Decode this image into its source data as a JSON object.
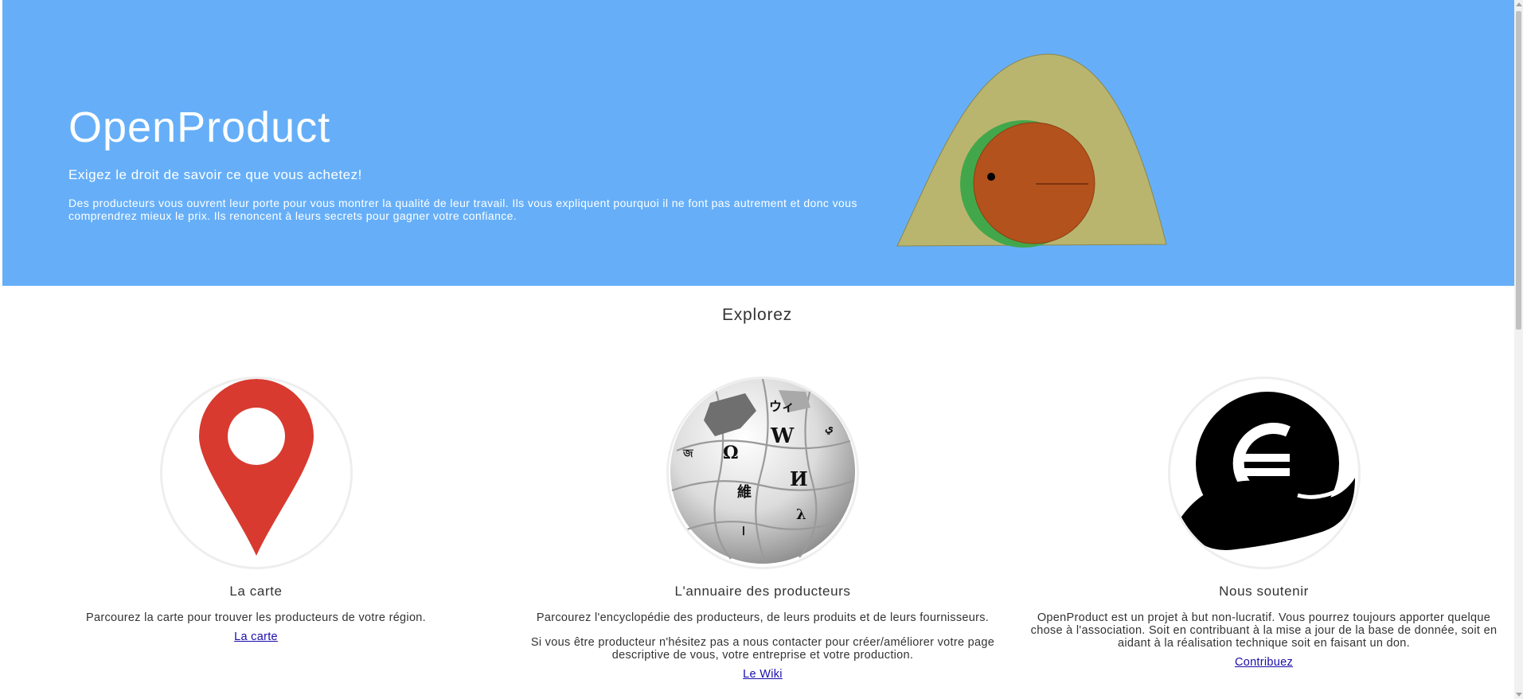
{
  "hero": {
    "title": "OpenProduct",
    "tagline": "Exigez le droit de savoir ce que vous achetez!",
    "description": "Des producteurs vous ouvrent leur porte pour vous montrer la qualité de leur travail. Ils vous expliquent pourquoi il ne font pas autrement et donc vous comprendrez mieux le prix. Ils renoncent à leurs secrets pour gagner votre confiance.",
    "background_color": "#66aff8",
    "logo_icon": "avocado-logo-icon"
  },
  "explore": {
    "title": "Explorez",
    "columns": [
      {
        "icon": "map-pin-icon",
        "title": "La carte",
        "paragraphs": [
          "Parcourez la carte pour trouver les producteurs de votre région."
        ],
        "link": "La carte"
      },
      {
        "icon": "wikipedia-globe-icon",
        "title": "L'annuaire des producteurs",
        "paragraphs": [
          "Parcourez l'encyclopédie des producteurs, de leurs produits et de leurs fournisseurs.",
          "Si vous être producteur n'hésitez pas a nous contacter pour créer/améliorer votre page descriptive de vous, votre entreprise et votre production."
        ],
        "link": "Le Wiki"
      },
      {
        "icon": "euro-hand-icon",
        "title": "Nous soutenir",
        "paragraphs": [
          "OpenProduct est un projet à but non-lucratif. Vous pourrez toujours apporter quelque chose à l'association. Soit en contribuant à la mise a jour de la base de donnée, soit en aidant à la réalisation technique soit en faisant un don."
        ],
        "link": "Contribuez"
      }
    ]
  }
}
